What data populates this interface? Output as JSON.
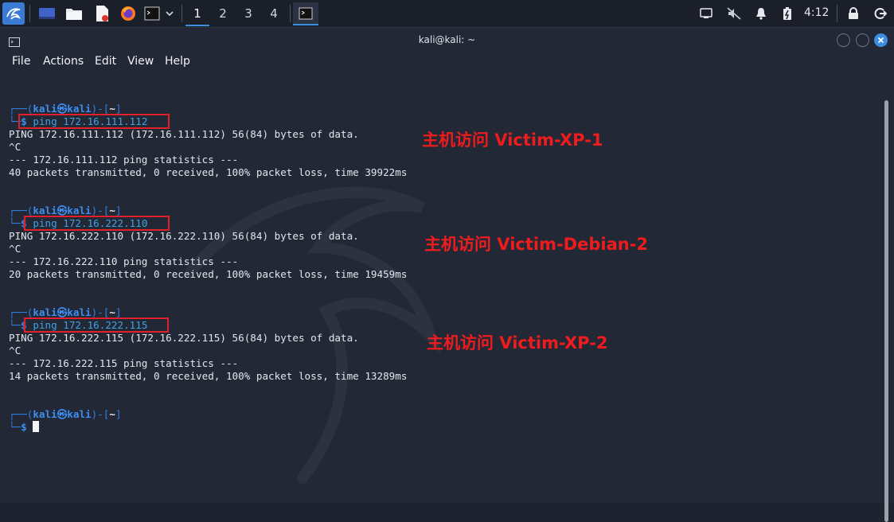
{
  "taskbar": {
    "workspaces": [
      "1",
      "2",
      "3",
      "4"
    ],
    "active_workspace": "1",
    "clock": "4:12",
    "accent": "#3b8fe0"
  },
  "window": {
    "title": "kali@kali: ~"
  },
  "menu": {
    "items": [
      "File",
      "Actions",
      "Edit",
      "View",
      "Help"
    ]
  },
  "terminal": {
    "prompt_user": "kali",
    "prompt_at": "㉿",
    "prompt_host": "kali",
    "prompt_dir": "~",
    "blocks": [
      {
        "command": "ping 172.16.111.112",
        "ping_header": "PING 172.16.111.112 (172.16.111.112) 56(84) bytes of data.",
        "interrupt": "^C",
        "stats_title": "--- 172.16.111.112 ping statistics ---",
        "stats": "40 packets transmitted, 0 received, 100% packet loss, time 39922ms",
        "annotation": "主机访问 Victim-XP-1"
      },
      {
        "command": "ping 172.16.222.110",
        "ping_header": "PING 172.16.222.110 (172.16.222.110) 56(84) bytes of data.",
        "interrupt": "^C",
        "stats_title": "--- 172.16.222.110 ping statistics ---",
        "stats": "20 packets transmitted, 0 received, 100% packet loss, time 19459ms",
        "annotation": "主机访问 Victim-Debian-2"
      },
      {
        "command": "ping 172.16.222.115",
        "ping_header": "PING 172.16.222.115 (172.16.222.115) 56(84) bytes of data.",
        "interrupt": "^C",
        "stats_title": "--- 172.16.222.115 ping statistics ---",
        "stats": "14 packets transmitted, 0 received, 100% packet loss, time 13289ms",
        "annotation": "主机访问 Victim-XP-2"
      }
    ],
    "annotation_color": "#ee1c1c",
    "highlight_box_color": "#e0202a"
  }
}
